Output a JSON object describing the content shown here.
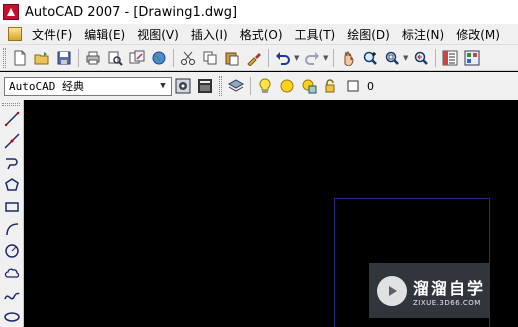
{
  "window": {
    "title": "AutoCAD 2007 - [Drawing1.dwg]"
  },
  "menu": {
    "items": [
      {
        "label": "文件(F)"
      },
      {
        "label": "编辑(E)"
      },
      {
        "label": "视图(V)"
      },
      {
        "label": "插入(I)"
      },
      {
        "label": "格式(O)"
      },
      {
        "label": "工具(T)"
      },
      {
        "label": "绘图(D)"
      },
      {
        "label": "标注(N)"
      },
      {
        "label": "修改(M)"
      }
    ]
  },
  "toolbar2": {
    "workspace_value": "AutoCAD 经典",
    "layer_value": "0"
  },
  "watermark": {
    "title": "溜溜自学",
    "url": "ZIXUE.3D66.COM"
  },
  "colors": {
    "canvas": "#000000",
    "chrome": "#f0f0f0",
    "viewport_border": "#2d2a8a"
  }
}
